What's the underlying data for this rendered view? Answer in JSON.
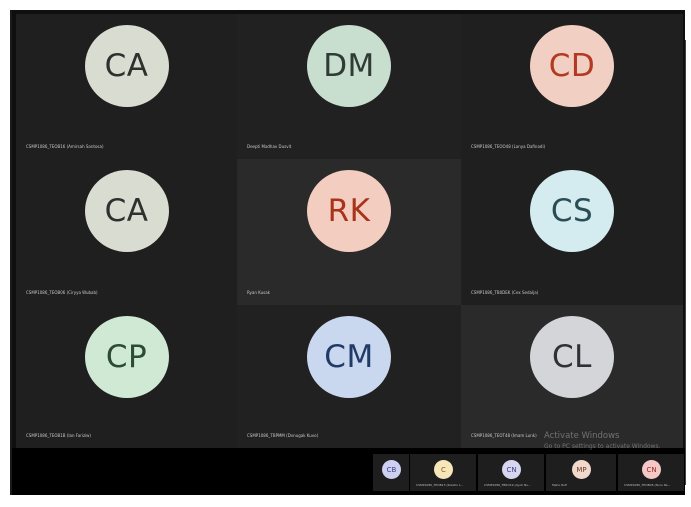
{
  "tiles": [
    {
      "initials": "CA",
      "name": "CSMP1086_TEOB16 (Amirsah Santosa)",
      "bg": "#d9dcd0",
      "fg": "#2f2f2f",
      "tile_bg": "#1f1f1f"
    },
    {
      "initials": "DM",
      "name": "Deepti Madhav Dusvit",
      "bg": "#c8dfd0",
      "fg": "#2f3b34",
      "tile_bg": "#212121"
    },
    {
      "initials": "CD",
      "name": "CSMP1086_TEOO48 (Lanya Dafinadi)",
      "bg": "#f2cfc3",
      "fg": "#b23a22",
      "tile_bg": "#1f1f1f"
    },
    {
      "initials": "CA",
      "name": "CSMP1086_TEOB06 (Ciryya Wubab)",
      "bg": "#d9dcd0",
      "fg": "#2f2f2f",
      "tile_bg": "#1f1f1f"
    },
    {
      "initials": "RK",
      "name": "Ryan Kusak",
      "bg": "#f3cdbf",
      "fg": "#a9321d",
      "tile_bg": "#2a2a2a"
    },
    {
      "initials": "CS",
      "name": "CSMP1086_TB0DEK (Cex Sedalja)",
      "bg": "#d4ecef",
      "fg": "#2a4c55",
      "tile_bg": "#1f1f1f"
    },
    {
      "initials": "CP",
      "name": "CSMP1086_TEOB1B (Ian Fariziw)",
      "bg": "#cfe9d5",
      "fg": "#2a4b36",
      "tile_bg": "#1f1f1f"
    },
    {
      "initials": "CM",
      "name": "CSMP1086_TBPMM (Dvnugak Kuvo)",
      "bg": "#cad8ef",
      "fg": "#213a66",
      "tile_bg": "#212121"
    },
    {
      "initials": "CL",
      "name": "CSMP1086_TEOT48 (Imam Lunk)",
      "bg": "#d3d5d8",
      "fg": "#2f3136",
      "tile_bg": "#2a2a2a"
    }
  ],
  "strip": [
    {
      "initials": "CB",
      "name": "",
      "bg": "#cdd0f0",
      "fg": "#3c3f87"
    },
    {
      "initials": "C",
      "name": "CSMP1086_TEOB13 (Kulatin L...",
      "bg": "#f7e6ba",
      "fg": "#7d5d14"
    },
    {
      "initials": "CN",
      "name": "CSMP1086_TB0O19 (Ayob Nu...",
      "bg": "#d6d6ef",
      "fg": "#3c3f87"
    },
    {
      "initials": "MP",
      "name": "Mpho Rufi",
      "bg": "#f0d8cc",
      "fg": "#6b3b26"
    },
    {
      "initials": "CN",
      "name": "CSMP1086_TEOB06 (Nuru Re...",
      "bg": "#f4c8c5",
      "fg": "#a2262b"
    }
  ],
  "watermark": {
    "line1": "Activate Windows",
    "line2": "Go to PC settings to activate Windows."
  }
}
